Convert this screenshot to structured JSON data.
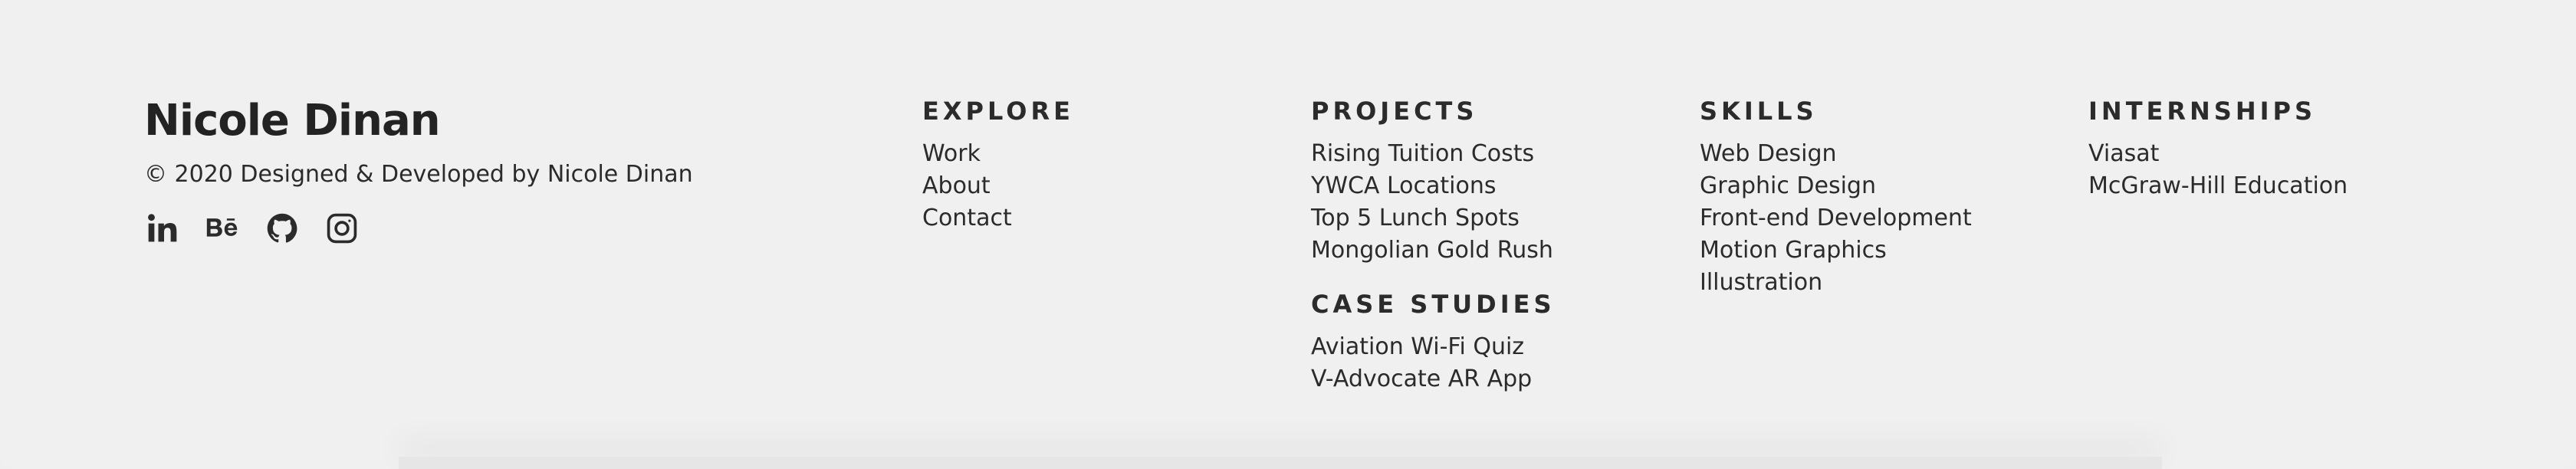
{
  "brand": {
    "name": "Nicole Dinan",
    "copyright": "© 2020 Designed & Developed by Nicole Dinan"
  },
  "social": [
    {
      "icon": "linkedin-icon"
    },
    {
      "icon": "behance-icon"
    },
    {
      "icon": "github-icon"
    },
    {
      "icon": "instagram-icon"
    }
  ],
  "columns": {
    "explore": {
      "heading": "EXPLORE",
      "items": [
        "Work",
        "About",
        "Contact"
      ]
    },
    "projects": {
      "heading": "PROJECTS",
      "items": [
        "Rising Tuition Costs",
        "YWCA Locations",
        "Top 5 Lunch Spots",
        "Mongolian Gold Rush"
      ]
    },
    "case_studies": {
      "heading": "CASE STUDIES",
      "items": [
        "Aviation Wi-Fi Quiz",
        "V-Advocate AR App"
      ]
    },
    "skills": {
      "heading": "SKILLS",
      "items": [
        "Web Design",
        "Graphic Design",
        "Front-end Development",
        "Motion Graphics",
        "Illustration"
      ]
    },
    "internships": {
      "heading": "INTERNSHIPS",
      "items": [
        "Viasat",
        "McGraw-Hill Education"
      ]
    }
  }
}
